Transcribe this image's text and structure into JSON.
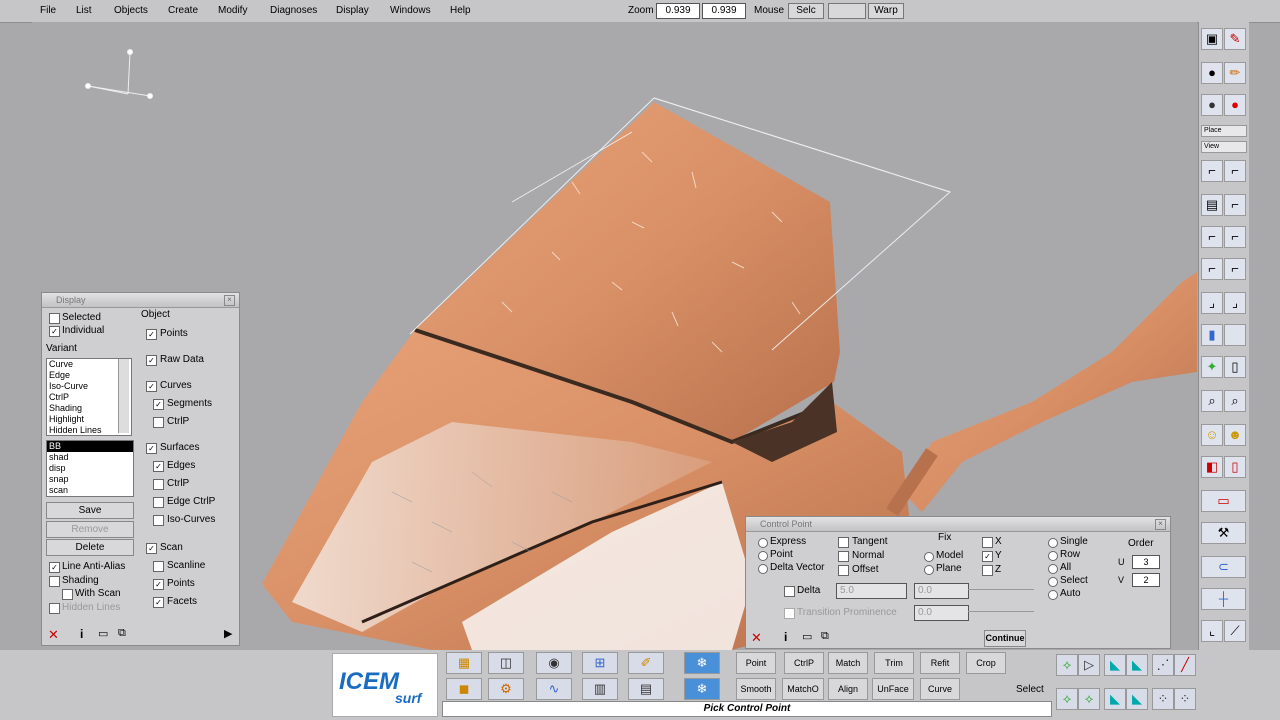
{
  "menu": [
    "File",
    "List",
    "Objects",
    "Create",
    "Modify",
    "Diagnoses",
    "Display",
    "Windows",
    "Help"
  ],
  "zoom": {
    "label": "Zoom",
    "value1": "0.939",
    "value2": "0.939"
  },
  "mouse": {
    "label": "Mouse",
    "selc": "Selc",
    "blank": "",
    "warp": "Warp"
  },
  "display_panel": {
    "title": "Display",
    "selected": "Selected",
    "individual": "Individual",
    "object": "Object",
    "variant": "Variant",
    "variants": [
      "Curve",
      "Edge",
      "Iso-Curve",
      "CtrlP",
      "Shading",
      "Highlight",
      "Hidden Lines"
    ],
    "modes": [
      "BB",
      "shad",
      "disp",
      "snap",
      "scan"
    ],
    "save": "Save",
    "remove": "Remove",
    "delete": "Delete",
    "line_anti_alias": "Line Anti-Alias",
    "shading": "Shading",
    "with_scan": "With Scan",
    "hidden_lines": "Hidden Lines",
    "points": "Points",
    "raw_data": "Raw Data",
    "curves": "Curves",
    "segments": "Segments",
    "ctrlp1": "CtrlP",
    "surfaces": "Surfaces",
    "edges": "Edges",
    "ctrlp2": "CtrlP",
    "edge_ctrlp": "Edge CtrlP",
    "iso_curves": "Iso-Curves",
    "scan": "Scan",
    "scanline": "Scanline",
    "scan_points": "Points",
    "facets": "Facets"
  },
  "control_point": {
    "title": "Control Point",
    "express": "Express",
    "point": "Point",
    "delta_vector": "Delta Vector",
    "tangent": "Tangent",
    "normal": "Normal",
    "offset": "Offset",
    "fix": "Fix",
    "model": "Model",
    "plane": "Plane",
    "x": "X",
    "y": "Y",
    "z": "Z",
    "single": "Single",
    "row": "Row",
    "all": "All",
    "select": "Select",
    "auto": "Auto",
    "order": "Order",
    "u": "U",
    "u_val": "3",
    "v": "V",
    "v_val": "2",
    "delta": "Delta",
    "delta_val": "5.0",
    "delta_val2": "0.0",
    "transition": "Transition Prominence",
    "transition_val": "0.0",
    "continue": "Continue"
  },
  "bottom": {
    "buttons": [
      "Point",
      "CtrlP",
      "Match",
      "Trim",
      "Refit",
      "Crop",
      "Smooth",
      "MatchO",
      "Align",
      "UnFace",
      "Curve"
    ],
    "select": "Select",
    "status": "Pick Control Point",
    "logo_main": "ICEM",
    "logo_sub": "surf"
  },
  "toolbar": {
    "place": "Place",
    "view": "View"
  }
}
